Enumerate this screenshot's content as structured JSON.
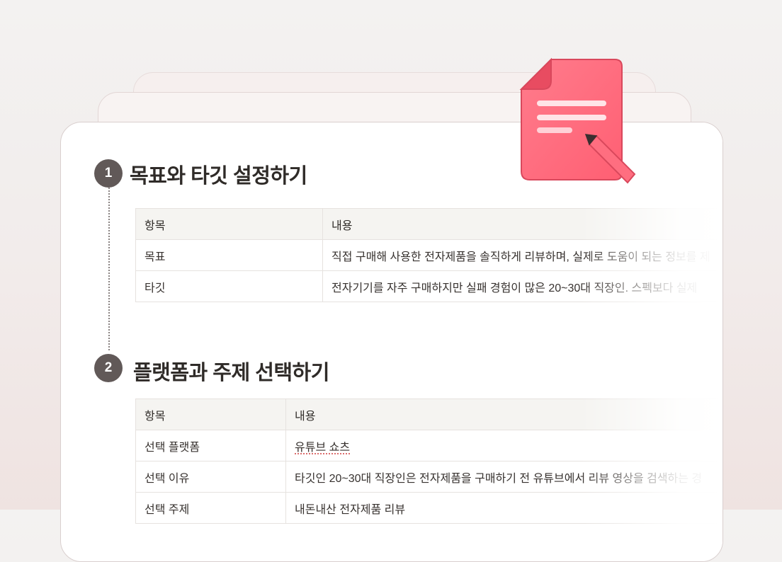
{
  "sections": [
    {
      "number": "1",
      "title": "목표와 타깃 설정하기",
      "table": {
        "headers": [
          "항목",
          "내용"
        ],
        "rows": [
          [
            "목표",
            "직접 구매해 사용한 전자제품을 솔직하게 리뷰하며, 실제로 도움이 되는 정보를 제"
          ],
          [
            "타깃",
            "전자기기를 자주 구매하지만 실패 경험이 많은 20~30대 직장인. 스펙보다 실제"
          ]
        ]
      }
    },
    {
      "number": "2",
      "title": "플랫폼과 주제 선택하기",
      "table": {
        "headers": [
          "항목",
          "내용"
        ],
        "rows": [
          [
            "선택 플랫폼",
            "유튜브 쇼츠"
          ],
          [
            "선택 이유",
            "타깃인 20~30대 직장인은 전자제품을 구매하기 전 유튜브에서 리뷰 영상을 검색하는 경"
          ],
          [
            "선택 주제",
            "내돈내산 전자제품 리뷰"
          ]
        ]
      }
    }
  ],
  "icons": {
    "document": "document-edit-icon",
    "pencil": "pencil-icon"
  },
  "colors": {
    "accent": "#ff6b7d",
    "step_badge": "#615958"
  }
}
